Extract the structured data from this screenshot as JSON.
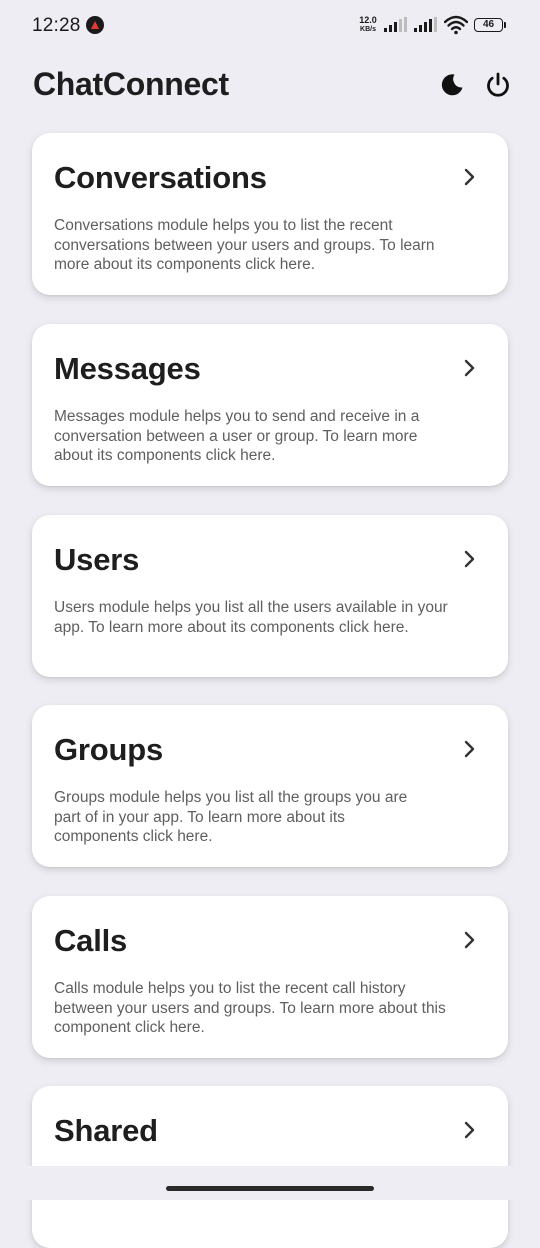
{
  "status_bar": {
    "time": "12:28",
    "net_speed_value": "12.0",
    "net_speed_unit": "KB/s",
    "battery": "46"
  },
  "header": {
    "title": "ChatConnect",
    "theme_icon": "moon-icon",
    "power_icon": "power-icon"
  },
  "modules": [
    {
      "title": "Conversations",
      "description": "Conversations module helps you to list the recent conversations between your users and groups. To learn more about its components click here."
    },
    {
      "title": "Messages",
      "description": "Messages module helps you to send and receive in a conversation between a user or group. To learn more about its components click here."
    },
    {
      "title": "Users",
      "description": "Users module helps you list all the users available in your app. To learn more about its components click here."
    },
    {
      "title": "Groups",
      "description": "Groups module helps you list all the groups you are part of in your app. To learn more about its components click here."
    },
    {
      "title": "Calls",
      "description": "Calls module helps you to list the recent call history between your users and groups. To learn more about this component click here."
    },
    {
      "title": "Shared",
      "description": ""
    }
  ]
}
